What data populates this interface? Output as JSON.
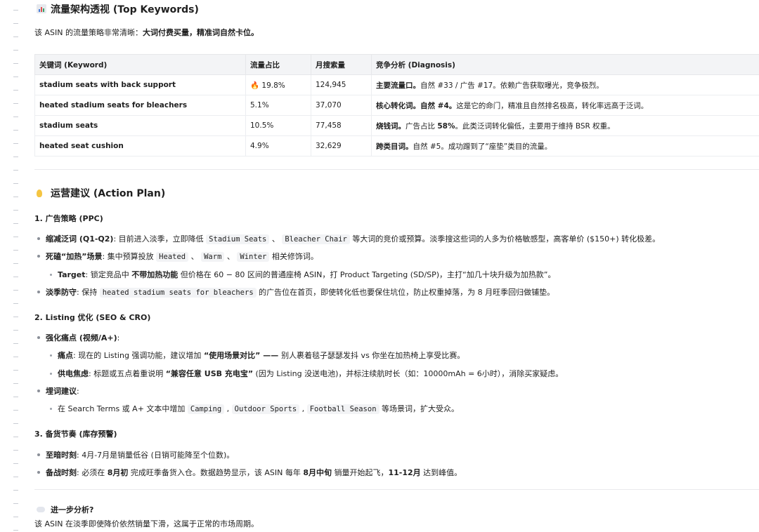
{
  "section1": {
    "title": "流量架构透视 (Top Keywords)",
    "intro_prefix": "该 ASIN 的流量策略非常清晰：",
    "intro_bold": "大词付费买量，精准词自然卡位。"
  },
  "table": {
    "headers": [
      "关键词 (Keyword)",
      "流量占比",
      "月搜索量",
      "竞争分析 (Diagnosis)"
    ],
    "rows": [
      {
        "keyword": "stadium seats with back support",
        "share": "19.8%",
        "share_icon": "fire-icon",
        "volume": "124,945",
        "diag_bold": "主要流量口。",
        "diag_rest": "自然 #33 / 广告 #17。依赖广告获取曝光，竞争极烈。"
      },
      {
        "keyword": "heated stadium seats for bleachers",
        "share": "5.1%",
        "volume": "37,070",
        "diag_bold": "核心转化词。自然 #4。",
        "diag_rest": "这是它的命门，精准且自然排名极高，转化率远高于泛词。"
      },
      {
        "keyword": "stadium seats",
        "share": "10.5%",
        "volume": "77,458",
        "diag_bold": "烧钱词。",
        "diag_mid": "广告占比 ",
        "diag_bold2": "58%",
        "diag_rest": "。此类泛词转化偏低，主要用于维持 BSR 权重。"
      },
      {
        "keyword": "heated seat cushion",
        "share": "4.9%",
        "volume": "32,629",
        "diag_bold": "跨类目词。",
        "diag_rest": "自然 #5。成功蹭到了“座垫”类目的流量。"
      }
    ]
  },
  "section2": {
    "title": "运营建议 (Action Plan)",
    "sub1": "1. 广告策略 (PPC)",
    "s1_b1_bold": "缩减泛词 (Q1-Q2)",
    "s1_b1_a": ": 目前进入淡季，立即降低 ",
    "s1_b1_code1": "Stadium Seats",
    "s1_b1_sep": " 、 ",
    "s1_b1_code2": "Bleacher Chair",
    "s1_b1_b": " 等大词的竞价或预算。淡季搜这些词的人多为价格敏感型，高客单价 ($150+) 转化极差。",
    "s1_b2_bold": "死磕“加热”场景",
    "s1_b2_a": ": 集中预算投放 ",
    "s1_b2_code1": "Heated",
    "s1_b2_sep1": " 、 ",
    "s1_b2_code2": "Warm",
    "s1_b2_sep2": " 、 ",
    "s1_b2_code3": "Winter",
    "s1_b2_b": " 相关修饰词。",
    "s1_b3_bold": "Target",
    "s1_b3_a": ": 锁定竞品中 ",
    "s1_b3_bold2": "不带加热功能",
    "s1_b3_b": " 但价格在 60 − 80 区间的普通座椅 ASIN，打 Product Targeting (SD/SP)，主打“加几十块升级为加热款”。",
    "s1_b4_bold": "淡季防守",
    "s1_b4_a": ": 保持 ",
    "s1_b4_code": "heated stadium seats for bleachers",
    "s1_b4_b": " 的广告位在首页，即使转化低也要保住坑位，防止权重掉落，为 8 月旺季回归做铺垫。",
    "sub2": "2. Listing 优化 (SEO & CRO)",
    "s2_b1_bold": "强化痛点 (视频/A+)",
    "s2_b1_a": ":",
    "s2_b2_bold": "痛点",
    "s2_b2_a": ": 现在的 Listing 强调功能，建议增加 ",
    "s2_b2_bold2": "“使用场景对比” —— ",
    "s2_b2_b": "别人裹着毯子瑟瑟发抖 vs 你坐在加热椅上享受比赛。",
    "s2_b3_bold": "供电焦虑",
    "s2_b3_a": ": 标题或五点着重说明 ",
    "s2_b3_bold2": "“兼容任意 USB 充电宝”",
    "s2_b3_b": " (因为 Listing 没送电池)，并标注续航时长（如：10000mAh = 6小时），消除买家疑虑。",
    "s2_b4_bold": "埋词建议",
    "s2_b4_a": ":",
    "s2_b5_a": "在 Search Terms 或 A+ 文本中增加 ",
    "s2_b5_code1": "Camping",
    "s2_b5_sep1": " , ",
    "s2_b5_code2": "Outdoor Sports",
    "s2_b5_sep2": " , ",
    "s2_b5_code3": "Football Season",
    "s2_b5_b": " 等场景词，扩大受众。",
    "sub3": "3. 备货节奏 (库存预警)",
    "s3_b1_bold": "至暗时刻",
    "s3_b1_a": ": 4月-7月是销量低谷 (日销可能降至个位数)。",
    "s3_b2_bold": "备战时刻",
    "s3_b2_a": ": 必须在 ",
    "s3_b2_bold2": "8月初",
    "s3_b2_b": " 完成旺季备货入仓。数据趋势显示，该 ASIN 每年 ",
    "s3_b2_bold3": "8月中旬",
    "s3_b2_c": " 销量开始起飞，",
    "s3_b2_bold4": "11-12月",
    "s3_b2_d": " 达到峰值。"
  },
  "section3": {
    "title": "进一步分析?",
    "text": "该 ASIN 在淡季即使降价依然销量下滑，这属于正常的市场周期。"
  }
}
